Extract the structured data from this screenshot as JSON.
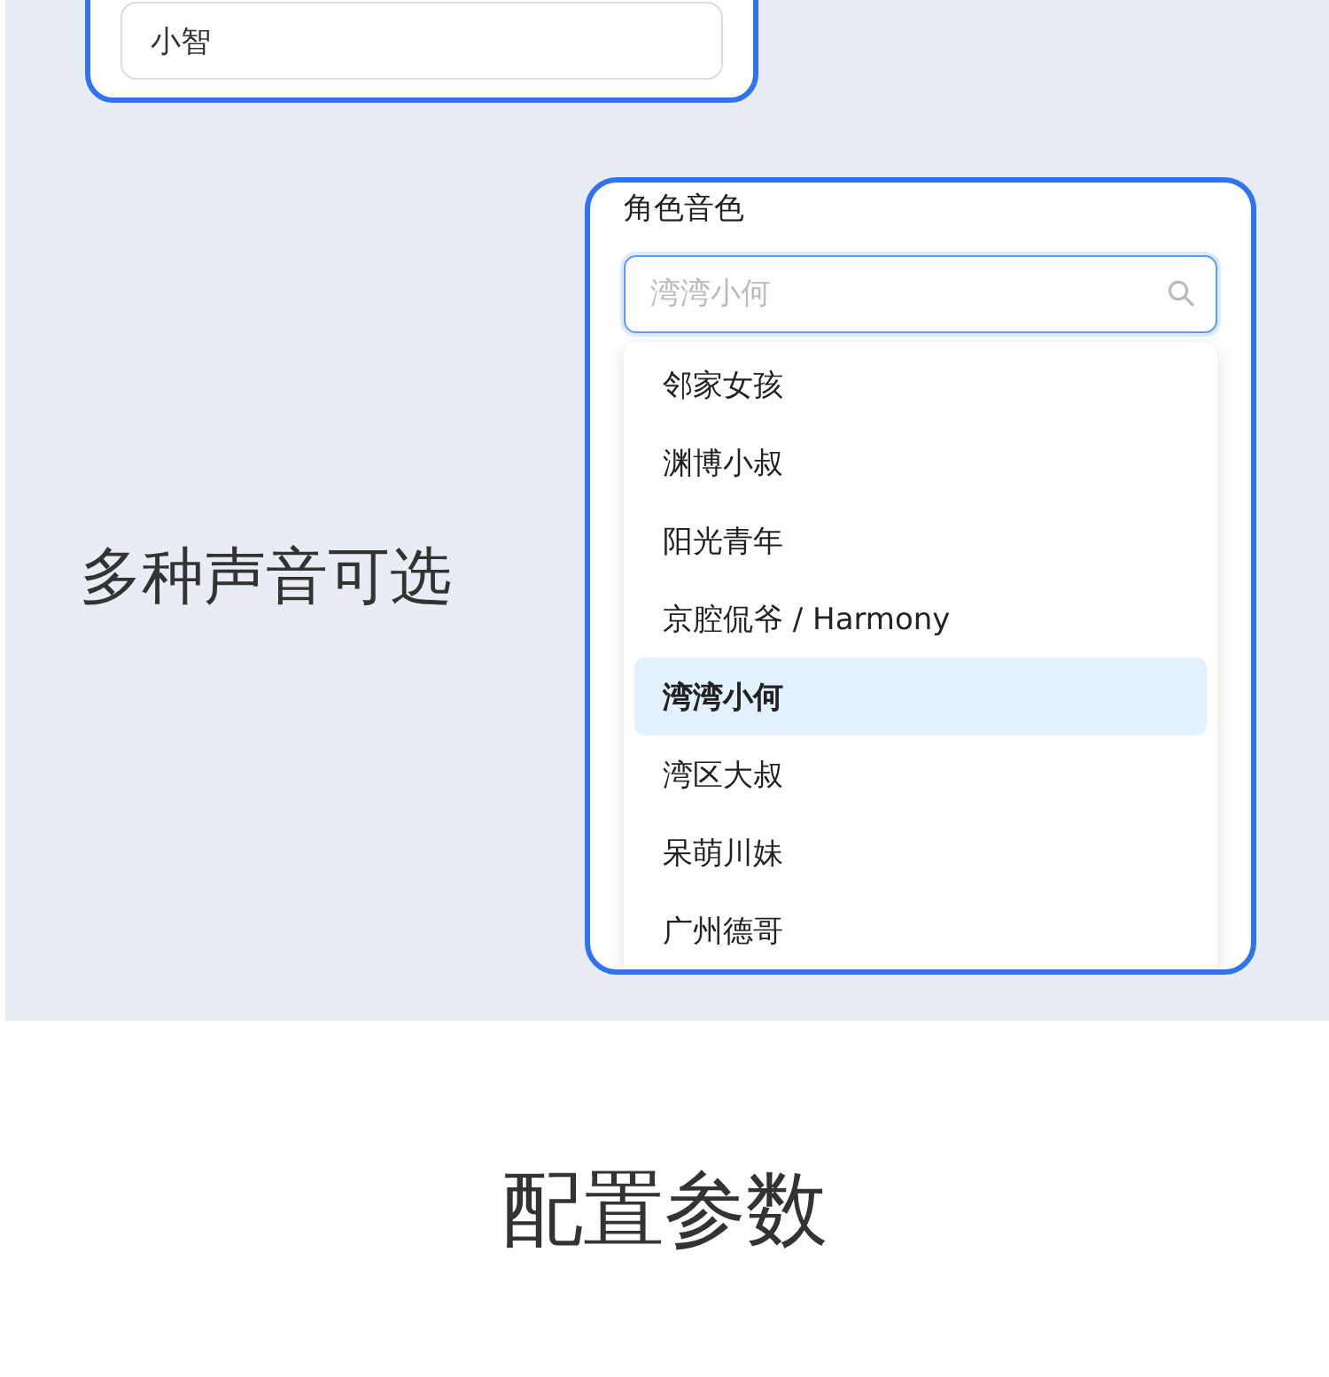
{
  "name_card": {
    "value": "小智"
  },
  "feature_title": "多种声音可选",
  "voice_card": {
    "label": "角色音色",
    "search": {
      "placeholder": "湾湾小何"
    },
    "options": [
      {
        "label": "邻家女孩",
        "selected": false
      },
      {
        "label": "渊博小叔",
        "selected": false
      },
      {
        "label": "阳光青年",
        "selected": false
      },
      {
        "label": "京腔侃爷 / Harmony",
        "selected": false
      },
      {
        "label": "湾湾小何",
        "selected": true
      },
      {
        "label": "湾区大叔",
        "selected": false
      },
      {
        "label": "呆萌川妹",
        "selected": false
      },
      {
        "label": "广州德哥",
        "selected": false
      }
    ]
  },
  "section_heading": "配置参数"
}
